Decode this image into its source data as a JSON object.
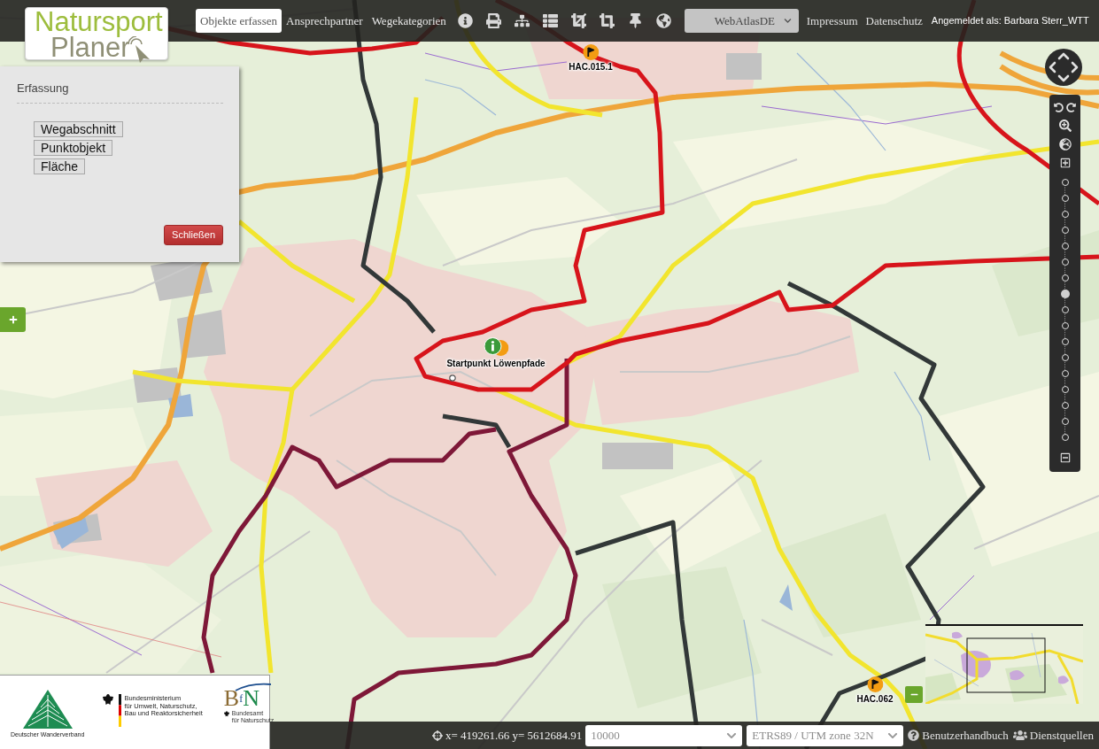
{
  "header": {
    "logo": {
      "line_1": "Natursport",
      "line_2": "Planer"
    },
    "nav": [
      {
        "label": "Objekte erfassen",
        "selected": true
      },
      {
        "label": "Ansprechpartner",
        "selected": false
      },
      {
        "label": "Wegekategorien",
        "selected": false
      }
    ],
    "basemap_select": {
      "value": "WebAtlasDE"
    },
    "links": [
      "Impressum",
      "Datenschutz"
    ],
    "user": "Angemeldet als: Barbara Sterr_WTT"
  },
  "capture_panel": {
    "title": "Erfassung",
    "options": [
      "Wegabschnitt",
      "Punktobjekt",
      "Fläche"
    ],
    "close_button": "Schließen"
  },
  "map": {
    "markers": [
      {
        "kind": "flag",
        "label": "HAC.015.1"
      },
      {
        "kind": "start",
        "label": "Startpunkt Löwenpfade"
      },
      {
        "kind": "flag",
        "label": "HAC.062"
      }
    ],
    "zoom_slider": {
      "level": 0.5625
    }
  },
  "partners": {
    "hiking_association": "Deutscher Wanderverband",
    "ministry": [
      "Bundesministerium",
      "für Umwelt, Naturschutz,",
      "Bau und Reaktorsicherheit"
    ],
    "agency_initials": [
      "B",
      "f",
      "N"
    ],
    "agency": [
      "Bundesamt",
      "für Naturschutz"
    ]
  },
  "status_bar": {
    "coordinates": "x= 419261.66 y= 5612684.91",
    "scale_select": {
      "value": "10000"
    },
    "crs_select": {
      "value": "ETRS89 / UTM zone 32N"
    },
    "links": [
      {
        "kind": "help",
        "label": "Benutzerhandbuch"
      },
      {
        "kind": "sources",
        "label": "Dienstquellen"
      }
    ]
  }
}
